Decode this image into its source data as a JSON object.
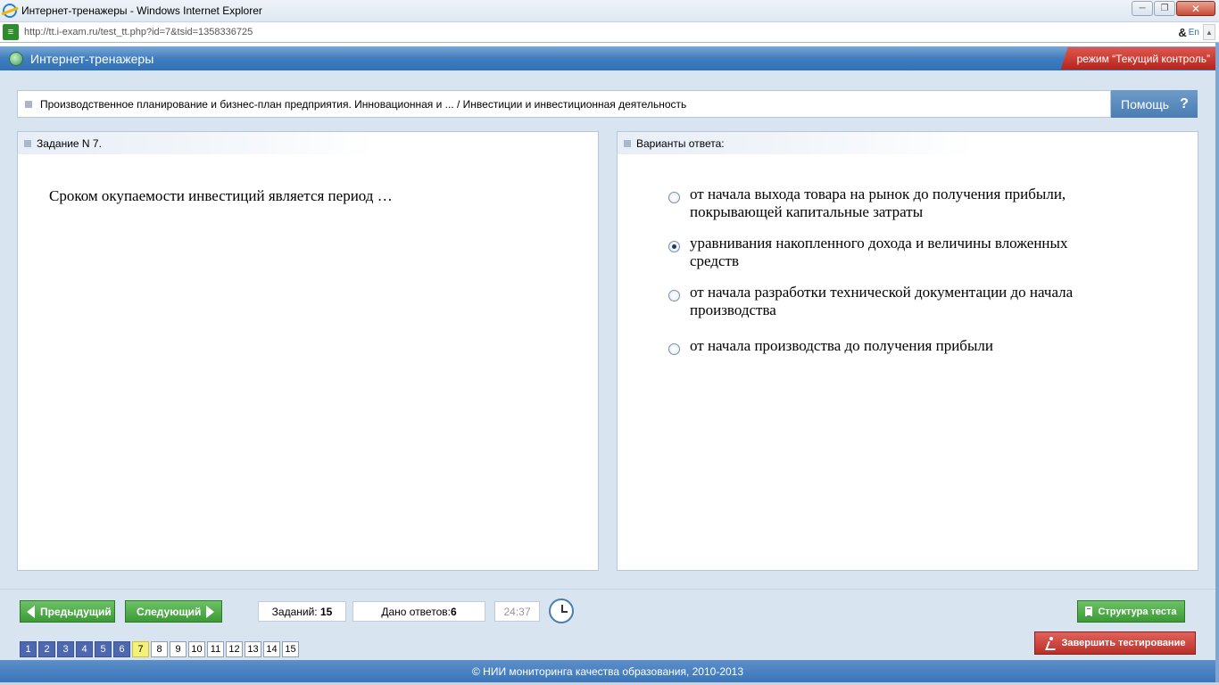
{
  "window": {
    "title": "Интернет-тренажеры - Windows Internet Explorer",
    "url": "http://tt.i-exam.ru/test_tt.php?id=7&tsid=1358336725",
    "compat_glyph": "&",
    "lang_glyph": "En"
  },
  "app": {
    "title": "Интернет-тренажеры",
    "mode": "режим “Текущий контроль”"
  },
  "breadcrumb": "Производственное планирование и бизнес-план предприятия. Инновационная и ... / Инвестиции и инвестиционная деятельность",
  "help": {
    "label": "Помощь",
    "icon": "?"
  },
  "task": {
    "header": "Задание N 7.",
    "question": "Сроком окупаемости инвестиций является период …"
  },
  "answers": {
    "header": "Варианты ответа:",
    "options": [
      {
        "text_line1": "от начала выхода товара на рынок до получения прибыли,",
        "text_line2": "покрывающей капитальные затраты",
        "selected": false
      },
      {
        "text_line1": "уравнивания накопленного дохода и величины вложенных",
        "text_line2": "средств",
        "selected": true
      },
      {
        "text_line1": "от начала разработки технической документации до начала",
        "text_line2": "производства",
        "selected": false
      },
      {
        "text_line1": "от начала производства до получения прибыли",
        "text_line2": "",
        "selected": false
      }
    ]
  },
  "nav": {
    "prev_label": "Предыдущий",
    "next_label": "Следующий",
    "tasks_label": "Заданий:",
    "tasks_count": "15",
    "answers_label": "Дано ответов:",
    "answers_count": "6",
    "timer": "24:37",
    "structure_label": "Структура теста",
    "finish_label": "Завершить тестирование"
  },
  "pager": {
    "pages": [
      "1",
      "2",
      "3",
      "4",
      "5",
      "6",
      "7",
      "8",
      "9",
      "10",
      "11",
      "12",
      "13",
      "14",
      "15"
    ],
    "answered_up_to": 6,
    "current": 7
  },
  "footer": "© НИИ мониторинга качества образования, 2010-2013",
  "colors": {
    "header_blue": "#3f7dbf",
    "mode_red": "#b3261e",
    "nav_green": "#3d9a36",
    "finish_red": "#b9302a",
    "page_done": "#4d68b0",
    "page_current": "#f4f07a"
  }
}
